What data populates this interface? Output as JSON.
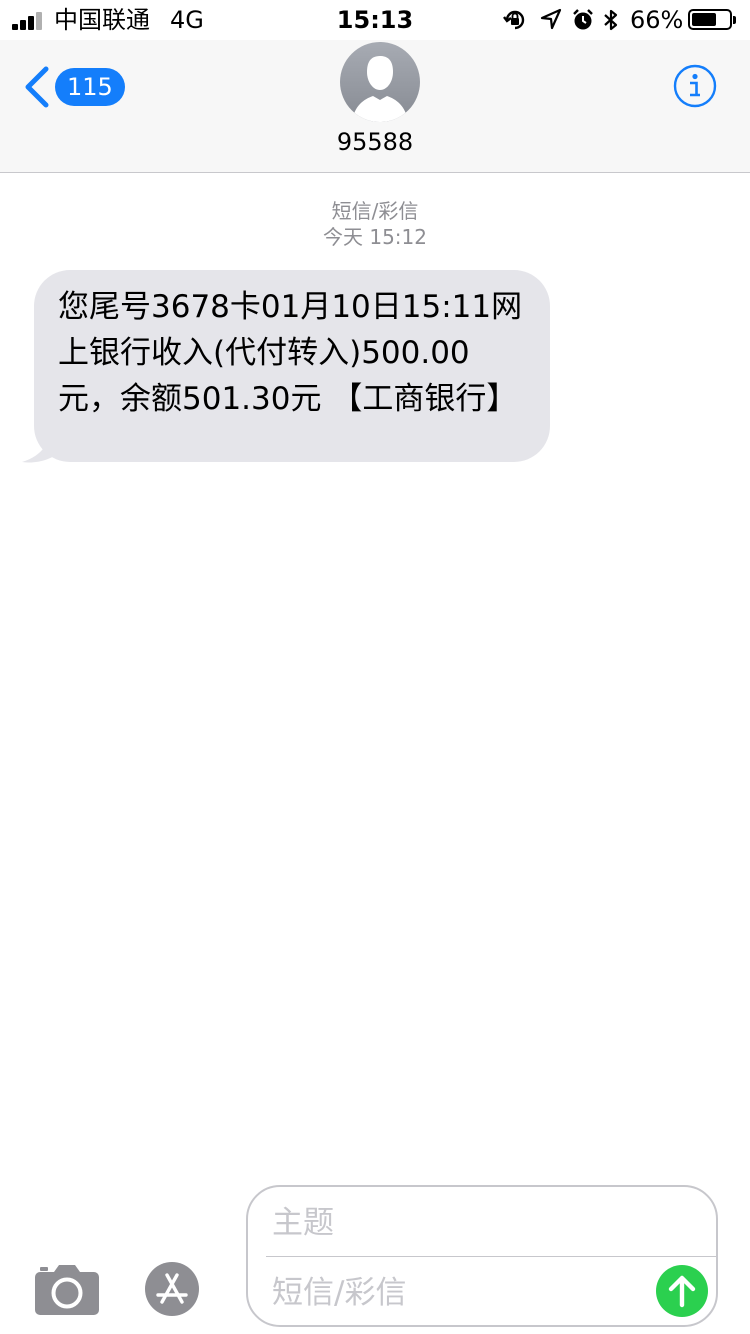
{
  "status_bar": {
    "carrier": "中国联通",
    "network": "4G",
    "time": "15:13",
    "battery_percent": "66%",
    "battery_level": 0.66
  },
  "header": {
    "back_badge": "115",
    "contact_name": "95588",
    "accent_color": "#147efb"
  },
  "thread": {
    "message_type": "短信/彩信",
    "timestamp": "今天 15:12",
    "messages": [
      {
        "direction": "incoming",
        "text": "您尾号3678卡01月10日15:11网上银行收入(代付转入)500.00元，余额501.30元 【工商银行】"
      }
    ]
  },
  "compose": {
    "subject_placeholder": "主题",
    "body_placeholder": "短信/彩信",
    "send_color": "#2bd04f"
  },
  "icons": [
    "camera-icon",
    "app-store-icon",
    "send-arrow-icon",
    "info-icon",
    "back-chevron-icon"
  ]
}
